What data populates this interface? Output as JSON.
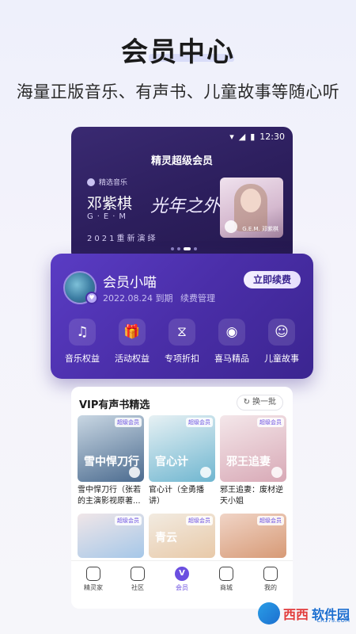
{
  "headline": "会员中心",
  "subheadline": "海量正版音乐、有声书、儿童故事等随心听",
  "statusbar": {
    "time": "12:30"
  },
  "banner": {
    "title": "精灵超级会员",
    "tag": "精选音乐",
    "artist": "邓紫棋",
    "artist_en": "G·E·M",
    "album_script": "光年之外",
    "subtitle": "2021重新演绎",
    "photo_caption": "G.E.M. 邓紫棋"
  },
  "member": {
    "name": "会员小喵",
    "expiry": "2022.08.24 到期",
    "manage": "续费管理",
    "renew_label": "立即续费",
    "benefits": [
      {
        "icon": "music-note-icon",
        "glyph": "♫",
        "label": "音乐权益"
      },
      {
        "icon": "gift-icon",
        "glyph": "🎁",
        "label": "活动权益"
      },
      {
        "icon": "discount-icon",
        "glyph": "⧖",
        "label": "专项折扣"
      },
      {
        "icon": "audio-wave-icon",
        "glyph": "◉",
        "label": "喜马精品"
      },
      {
        "icon": "kid-robot-icon",
        "glyph": "☺",
        "label": "儿童故事"
      }
    ]
  },
  "books": {
    "title": "VIP有声书精选",
    "refresh_label": "换一批",
    "badge": "超级会员",
    "items": [
      {
        "cover_text": "雪中悍刀行",
        "title": "雪中悍刀行（张若的主演影视原著...",
        "color_a": "#4b6b8f",
        "color_b": "#c9d7e3"
      },
      {
        "cover_text": "官心计",
        "title": "官心计（全勇播讲）",
        "color_a": "#6fb6d0",
        "color_b": "#e7f1f4"
      },
      {
        "cover_text": "邪王追妻",
        "title": "邪王追妻：废材逆天小姐",
        "color_a": "#d8a9b6",
        "color_b": "#f4e7ea"
      },
      {
        "cover_text": "",
        "title": "",
        "color_a": "#a5c7e8",
        "color_b": "#f0e6e8"
      },
      {
        "cover_text": "青云",
        "title": "",
        "color_a": "#e8c9a8",
        "color_b": "#f2ebe1"
      },
      {
        "cover_text": "",
        "title": "",
        "color_a": "#d79a76",
        "color_b": "#f0d4c6"
      }
    ]
  },
  "tabs": [
    {
      "label": "精灵家",
      "active": false
    },
    {
      "label": "社区",
      "active": false
    },
    {
      "label": "会员",
      "active": true
    },
    {
      "label": "商城",
      "active": false
    },
    {
      "label": "我的",
      "active": false
    }
  ],
  "watermark": {
    "part1": "西西",
    "part2": "软件园",
    "sub": "CR173.COM"
  }
}
